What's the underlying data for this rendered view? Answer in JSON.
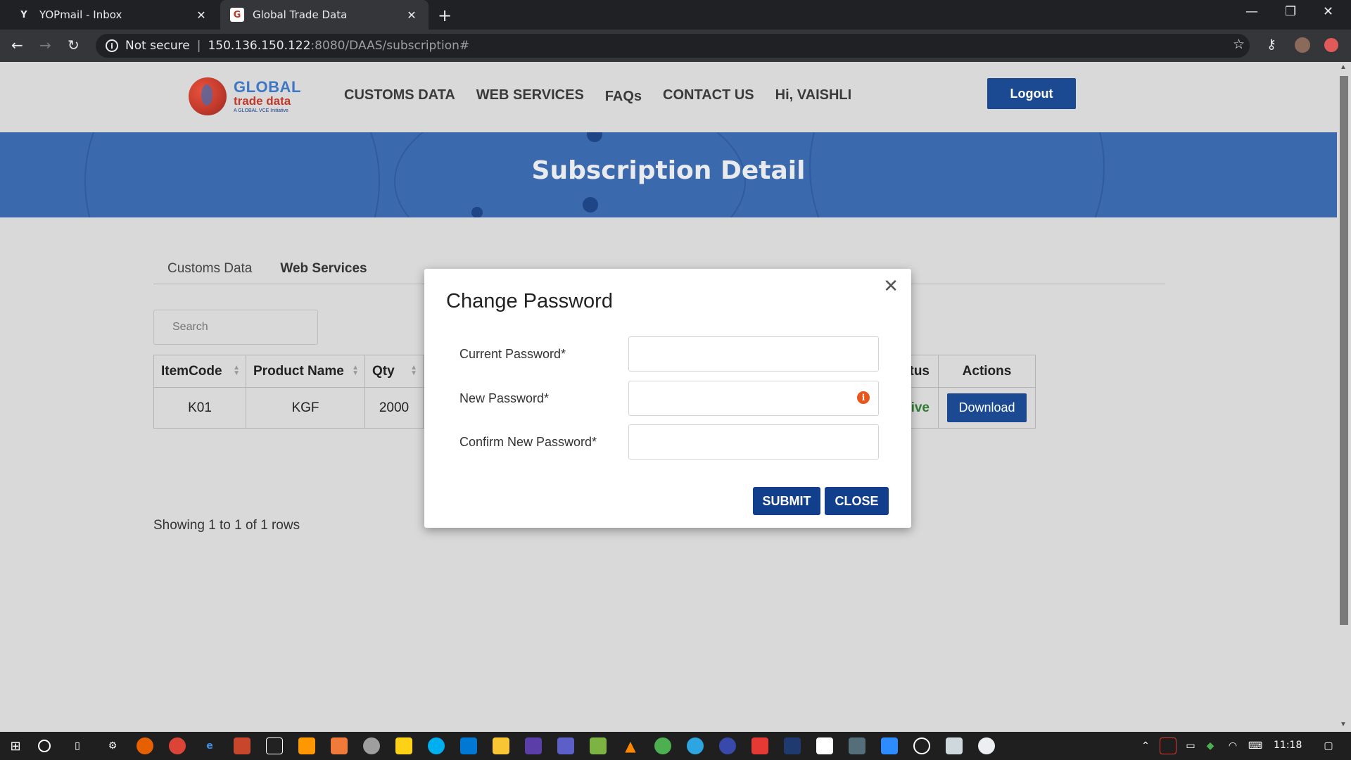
{
  "browser": {
    "tabs": [
      {
        "title": "YOPmail - Inbox",
        "favicon": "Y",
        "active": false
      },
      {
        "title": "Global Trade Data",
        "favicon": "G",
        "active": true
      }
    ],
    "new_tab": "+",
    "security_label": "Not secure",
    "url_host": "150.136.150.122",
    "url_path": ":8080/DAAS/subscription#"
  },
  "site": {
    "logo": {
      "line1": "GLOBAL",
      "line2": "trade data",
      "line3": "A GLOBAL VCE Initiative"
    },
    "nav": [
      "CUSTOMS DATA",
      "WEB SERVICES",
      "FAQs",
      "CONTACT US",
      "Hi, VAISHLI"
    ],
    "logout_label": "Logout",
    "hero_title": "Subscription Detail",
    "tabs": [
      "Customs Data",
      "Web Services"
    ],
    "search_placeholder": "Search",
    "table": {
      "headers": [
        "ItemCode",
        "Product Name",
        "Qty",
        "tus",
        "Actions"
      ],
      "row": {
        "itemcode": "K01",
        "product": "KGF",
        "qty": "2000",
        "status": "ive",
        "action": "Download"
      }
    },
    "showing": "Showing 1 to 1 of 1 rows"
  },
  "modal": {
    "title": "Change Password",
    "fields": [
      {
        "label": "Current Password*",
        "value": ""
      },
      {
        "label": "New Password*",
        "value": ""
      },
      {
        "label": "Confirm New Password*",
        "value": ""
      }
    ],
    "submit_label": "SUBMIT",
    "close_label": "CLOSE"
  },
  "taskbar": {
    "time": "11:18"
  },
  "colors": {
    "primary": "#1c4a92",
    "hero": "#3a69ad",
    "page_bg": "#d9d9d9",
    "status_active": "#2e7d32"
  }
}
